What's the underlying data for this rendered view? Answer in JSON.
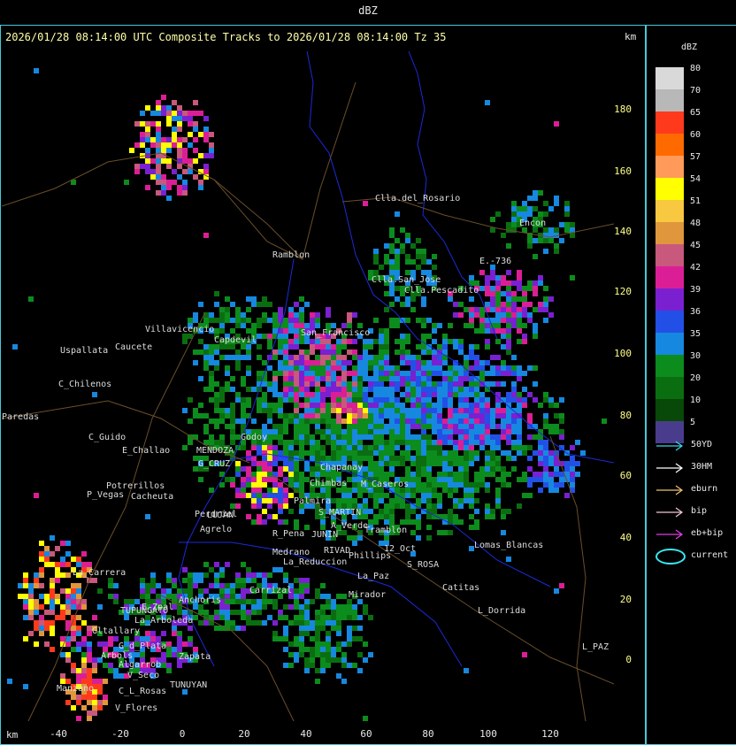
{
  "header": {
    "title": "dBZ",
    "subtitle": "2026/01/28 08:14:00 UTC Composite Tracks to 2026/01/28 08:14:00 Tz 35",
    "km_top": "km",
    "km_bottom": "km"
  },
  "y_ticks": [
    "180",
    "160",
    "140",
    "120",
    "100",
    "80",
    "60",
    "40",
    "20",
    "0"
  ],
  "x_ticks": [
    "-40",
    "-20",
    "0",
    "20",
    "40",
    "60",
    "80",
    "100",
    "120"
  ],
  "legend": {
    "title": "dBZ",
    "levels": [
      {
        "label": "80",
        "color": "#d9d9d9"
      },
      {
        "label": "70",
        "color": "#b8b8b8"
      },
      {
        "label": "65",
        "color": "#ff3a1c"
      },
      {
        "label": "60",
        "color": "#ff6a00"
      },
      {
        "label": "57",
        "color": "#ff9a5a"
      },
      {
        "label": "54",
        "color": "#ffff00"
      },
      {
        "label": "51",
        "color": "#f8c840"
      },
      {
        "label": "48",
        "color": "#e0963c"
      },
      {
        "label": "45",
        "color": "#c8587c"
      },
      {
        "label": "42",
        "color": "#dc1e96"
      },
      {
        "label": "39",
        "color": "#7a20d0"
      },
      {
        "label": "36",
        "color": "#2250e6"
      },
      {
        "label": "35",
        "color": "#1688e0"
      },
      {
        "label": "30",
        "color": "#0c8c1c"
      },
      {
        "label": "20",
        "color": "#0a6e10"
      },
      {
        "label": "10",
        "color": "#084808"
      },
      {
        "label": "5",
        "color": "#4a3c8c"
      }
    ],
    "tracks": [
      {
        "label": "50YD",
        "color": "#38d8e8"
      },
      {
        "label": "30HM",
        "color": "#ffffff"
      },
      {
        "label": "eburn",
        "color": "#f0c078"
      },
      {
        "label": "bip",
        "color": "#f4c8d8"
      },
      {
        "label": "eb+bip",
        "color": "#e040e0"
      }
    ],
    "current_label": "current",
    "current_color": "#38e8f0"
  },
  "places": [
    {
      "name": "Clla.del_Rosario"
    },
    {
      "name": "Encon"
    },
    {
      "name": "E.-736"
    },
    {
      "name": "Ramblon"
    },
    {
      "name": "Clla.San_Jose"
    },
    {
      "name": "Clla.Pescadito"
    },
    {
      "name": "Villavicencio"
    },
    {
      "name": "Caucete"
    },
    {
      "name": "Capdevil"
    },
    {
      "name": "San_Francisco"
    },
    {
      "name": "Uspallata"
    },
    {
      "name": "C_Chilenos"
    },
    {
      "name": "Paredas"
    },
    {
      "name": "C_Guido"
    },
    {
      "name": "E_Challao"
    },
    {
      "name": "MENDOZA"
    },
    {
      "name": "G_CRUZ"
    },
    {
      "name": "Godoy"
    },
    {
      "name": "Chapanay"
    },
    {
      "name": "Chimbas"
    },
    {
      "name": "M_Caseros"
    },
    {
      "name": "Potrerillos"
    },
    {
      "name": "P_Vegas"
    },
    {
      "name": "Cacheuta"
    },
    {
      "name": "LUJAN"
    },
    {
      "name": "Perdriel"
    },
    {
      "name": "Agrelo"
    },
    {
      "name": "Palmira"
    },
    {
      "name": "S_MARTIN"
    },
    {
      "name": "A_Verde"
    },
    {
      "name": "Tramblon"
    },
    {
      "name": "R_Pena"
    },
    {
      "name": "JUNIN"
    },
    {
      "name": "RIVAD"
    },
    {
      "name": "Phillips"
    },
    {
      "name": "12_Oct"
    },
    {
      "name": "Lomas_Blancas"
    },
    {
      "name": "La_Carrera"
    },
    {
      "name": "Medrano"
    },
    {
      "name": "La_Reduccion"
    },
    {
      "name": "S_ROSA"
    },
    {
      "name": "La_Paz"
    },
    {
      "name": "Catitas"
    },
    {
      "name": "Anchoris"
    },
    {
      "name": "Carrizal"
    },
    {
      "name": "TUPUNGATO"
    },
    {
      "name": "E_Zpal"
    },
    {
      "name": "La_Arboleda"
    },
    {
      "name": "Gltallary"
    },
    {
      "name": "G_d_Plata"
    },
    {
      "name": "Zapata"
    },
    {
      "name": "Arbols"
    },
    {
      "name": "Algarrob"
    },
    {
      "name": "V_Seco"
    },
    {
      "name": "TUNUYAN"
    },
    {
      "name": "C_L_Rosas"
    },
    {
      "name": "Manzano"
    },
    {
      "name": "V_Flores"
    },
    {
      "name": "Mirador"
    },
    {
      "name": "L_Dorrida"
    },
    {
      "name": "L_PAZ"
    }
  ]
}
